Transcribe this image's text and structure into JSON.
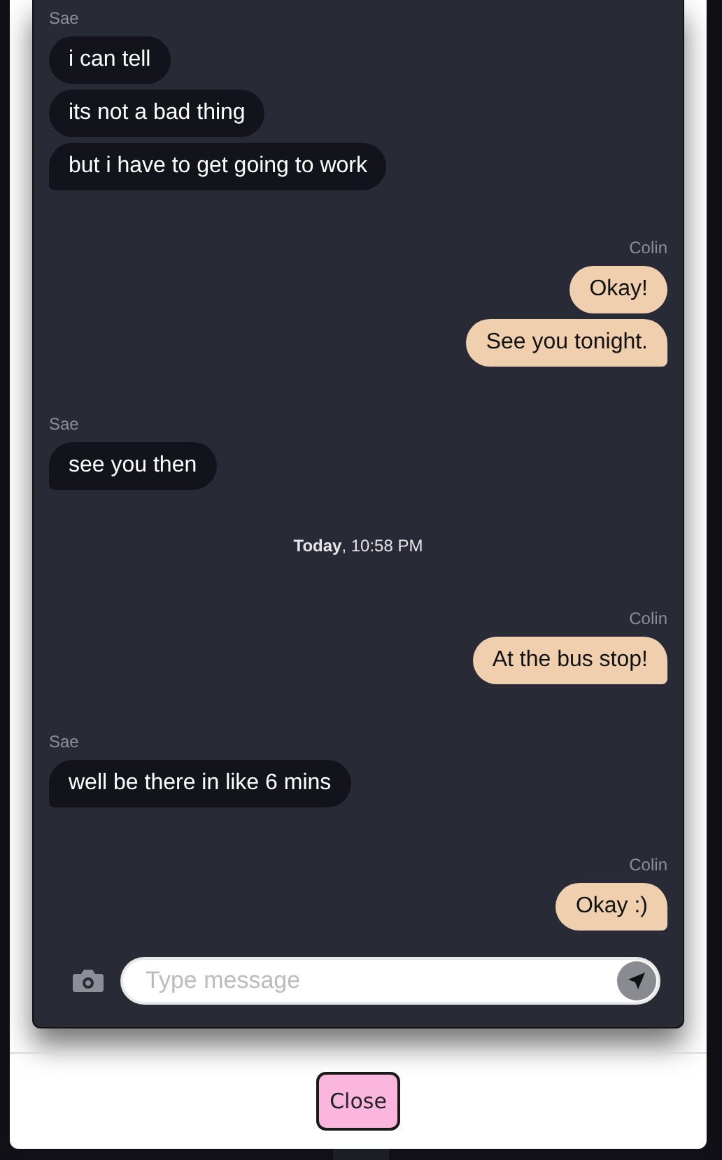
{
  "thread": [
    {
      "kind": "incoming",
      "sender": "Sae",
      "messages": [
        "i can tell",
        "its not a bad thing",
        "but i have to get going to work"
      ]
    },
    {
      "kind": "outgoing",
      "sender": "Colin",
      "messages": [
        "Okay!",
        "See you tonight."
      ]
    },
    {
      "kind": "incoming",
      "sender": "Sae",
      "messages": [
        "see you then"
      ]
    },
    {
      "kind": "timestamp",
      "text": "**Today**, 10:58 PM"
    },
    {
      "kind": "outgoing",
      "sender": "Colin",
      "messages": [
        "At the bus stop!"
      ]
    },
    {
      "kind": "incoming",
      "sender": "Sae",
      "messages": [
        "well be there in like 6 mins"
      ]
    },
    {
      "kind": "outgoing",
      "sender": "Colin",
      "messages": [
        "Okay :)"
      ]
    }
  ],
  "composer": {
    "placeholder": "Type message"
  },
  "footer": {
    "button": "Close"
  }
}
